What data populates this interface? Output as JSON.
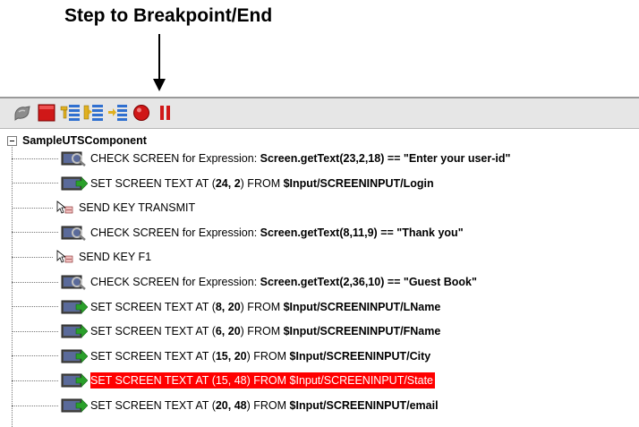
{
  "callout": {
    "label": "Step to Breakpoint/End"
  },
  "toolbar": {
    "buttons": [
      {
        "icon": "disconnect-icon"
      },
      {
        "icon": "stop-icon"
      },
      {
        "icon": "step-into-icon"
      },
      {
        "icon": "step-over-icon"
      },
      {
        "icon": "step-to-breakpoint-icon"
      },
      {
        "icon": "record-icon"
      },
      {
        "icon": "pause-icon"
      }
    ]
  },
  "tree": {
    "root": "SampleUTSComponent",
    "rows": [
      {
        "icon": "check-screen-icon",
        "prefix": "CHECK SCREEN for Expression: ",
        "expr": "Screen.getText(23,2,18) == \"Enter your user-id\""
      },
      {
        "icon": "set-screen-text-icon",
        "prefix": "SET SCREEN TEXT AT (",
        "pos": "24, 2",
        "mid": ") FROM ",
        "src": "$Input/SCREENINPUT/Login"
      },
      {
        "icon": "send-key-icon",
        "plain": "SEND KEY TRANSMIT"
      },
      {
        "icon": "check-screen-icon",
        "prefix": "CHECK SCREEN for Expression: ",
        "expr": "Screen.getText(8,11,9) == \"Thank you\""
      },
      {
        "icon": "send-key-icon",
        "plain": "SEND KEY F1"
      },
      {
        "icon": "check-screen-icon",
        "prefix": "CHECK SCREEN for Expression: ",
        "expr": "Screen.getText(2,36,10) == \"Guest Book\""
      },
      {
        "icon": "set-screen-text-icon",
        "prefix": "SET SCREEN TEXT AT (",
        "pos": "8, 20",
        "mid": ") FROM ",
        "src": "$Input/SCREENINPUT/LName"
      },
      {
        "icon": "set-screen-text-icon",
        "prefix": "SET SCREEN TEXT AT (",
        "pos": "6, 20",
        "mid": ") FROM ",
        "src": "$Input/SCREENINPUT/FName"
      },
      {
        "icon": "set-screen-text-icon",
        "prefix": "SET SCREEN TEXT AT (",
        "pos": "15, 20",
        "mid": ") FROM ",
        "src": "$Input/SCREENINPUT/City"
      },
      {
        "icon": "set-screen-text-icon",
        "plain": "SET SCREEN TEXT AT (15, 48) FROM $Input/SCREENINPUT/State",
        "selected": true
      },
      {
        "icon": "set-screen-text-icon",
        "prefix": "SET SCREEN TEXT AT (",
        "pos": "20, 48",
        "mid": ") FROM ",
        "src": "$Input/SCREENINPUT/email"
      }
    ]
  },
  "colors": {
    "selection": "#ff0000",
    "toolbar_bg": "#e6e6e6"
  }
}
